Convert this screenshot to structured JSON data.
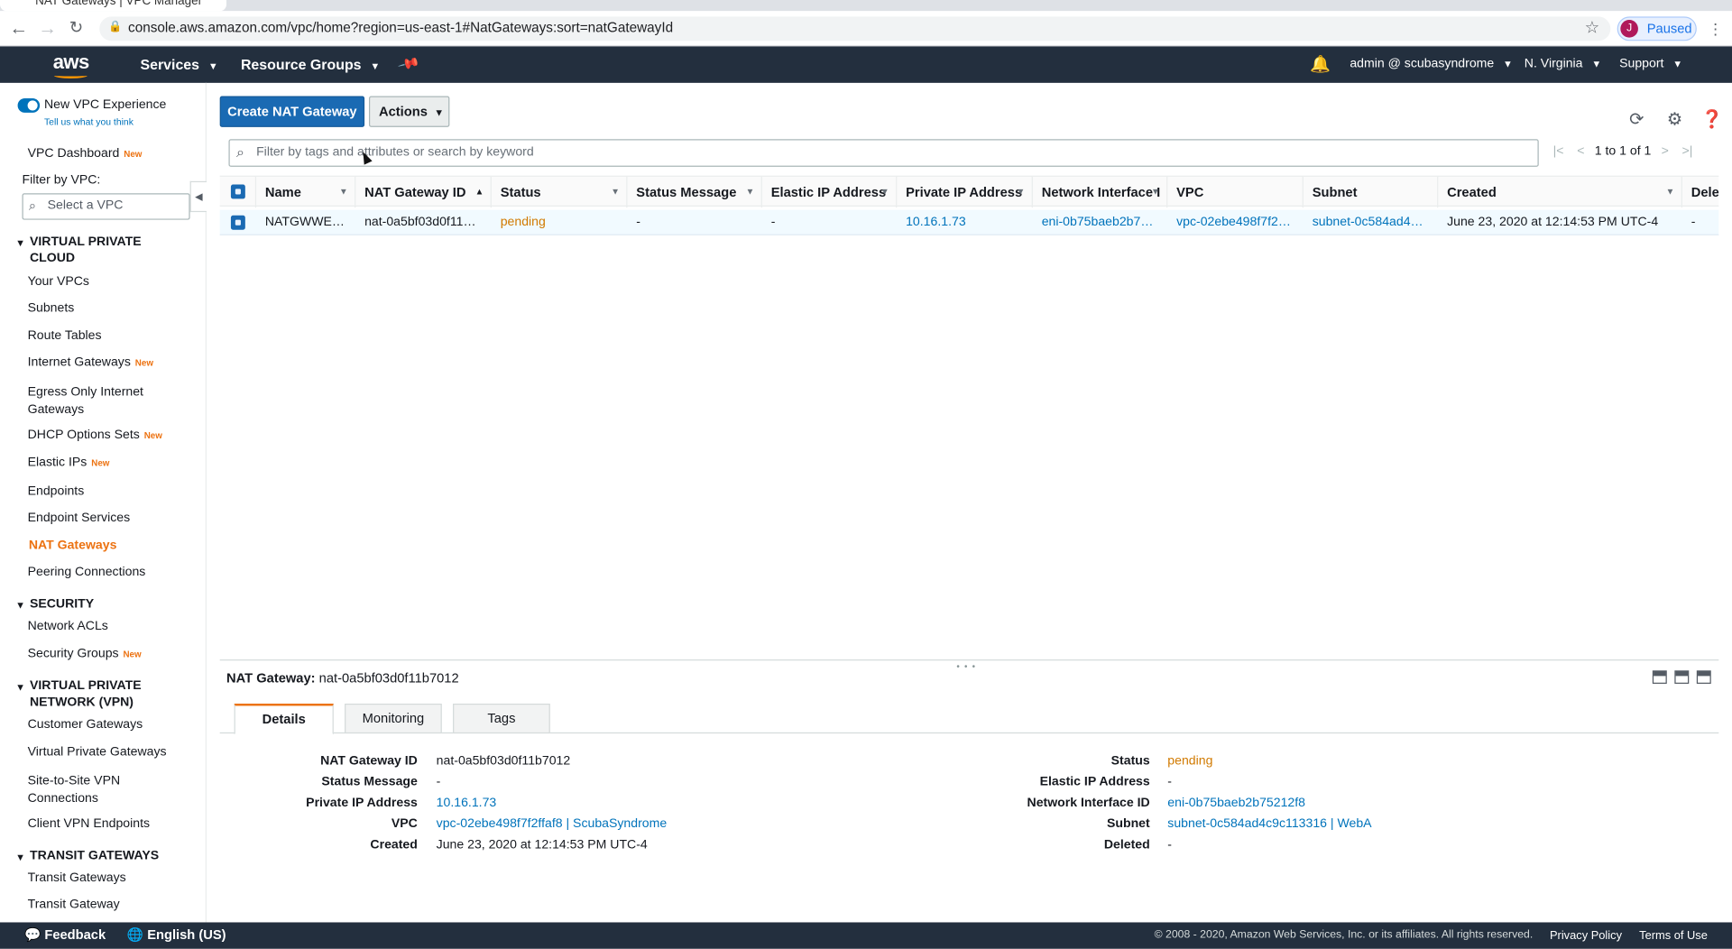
{
  "browser": {
    "tab_title": "NAT Gateways | VPC Manager",
    "url": "console.aws.amazon.com/vpc/home?region=us-east-1#NatGateways:sort=natGatewayId",
    "profile_initial": "J",
    "profile_status": "Paused"
  },
  "topnav": {
    "logo": "aws",
    "services": "Services",
    "resource_groups": "Resource Groups",
    "account": "admin @ scubasyndrome",
    "region": "N. Virginia",
    "support": "Support"
  },
  "sidebar": {
    "new_experience": "New VPC Experience",
    "tell_us": "Tell us what you think",
    "dashboard": "VPC Dashboard",
    "new_badge": "New",
    "filter_label": "Filter by VPC:",
    "vpc_placeholder": "Select a VPC",
    "sec_vpc": "VIRTUAL PRIVATE CLOUD",
    "items_vpc": [
      "Your VPCs",
      "Subnets",
      "Route Tables",
      "Internet Gateways",
      "Egress Only Internet Gateways",
      "DHCP Options Sets",
      "Elastic IPs",
      "Endpoints",
      "Endpoint Services",
      "NAT Gateways",
      "Peering Connections"
    ],
    "sec_security": "SECURITY",
    "items_security": [
      "Network ACLs",
      "Security Groups"
    ],
    "sec_vpn": "VIRTUAL PRIVATE NETWORK (VPN)",
    "items_vpn": [
      "Customer Gateways",
      "Virtual Private Gateways",
      "Site-to-Site VPN Connections",
      "Client VPN Endpoints"
    ],
    "sec_transit": "TRANSIT GATEWAYS",
    "items_transit": [
      "Transit Gateways",
      "Transit Gateway"
    ]
  },
  "toolbar": {
    "create": "Create NAT Gateway",
    "actions": "Actions",
    "search_placeholder": "Filter by tags and attributes or search by keyword",
    "pagination": "1 to 1 of 1"
  },
  "table": {
    "columns": [
      "Name",
      "NAT Gateway ID",
      "Status",
      "Status Message",
      "Elastic IP Address",
      "Private IP Address",
      "Network Interface I",
      "VPC",
      "Subnet",
      "Created",
      "Delet"
    ],
    "rows": [
      {
        "name": "NATGWWE…",
        "id": "nat-0a5bf03d0f11…",
        "status": "pending",
        "status_message": "-",
        "elastic_ip": "-",
        "private_ip": "10.16.1.73",
        "eni": "eni-0b75baeb2b7…",
        "vpc": "vpc-02ebe498f7f2…",
        "subnet": "subnet-0c584ad4…",
        "created": "June 23, 2020 at 12:14:53 PM UTC-4",
        "deleted": "-"
      }
    ]
  },
  "details": {
    "header_label": "NAT Gateway:",
    "header_id": "nat-0a5bf03d0f11b7012",
    "tabs": [
      "Details",
      "Monitoring",
      "Tags"
    ],
    "left": [
      {
        "label": "NAT Gateway ID",
        "value": "nat-0a5bf03d0f11b7012"
      },
      {
        "label": "Status Message",
        "value": "-"
      },
      {
        "label": "Private IP Address",
        "value": "10.16.1.73"
      },
      {
        "label": "VPC",
        "value": "vpc-02ebe498f7f2ffaf8 | ScubaSyndrome"
      },
      {
        "label": "Created",
        "value": "June 23, 2020 at 12:14:53 PM UTC-4"
      }
    ],
    "right": [
      {
        "label": "Status",
        "value": "pending"
      },
      {
        "label": "Elastic IP Address",
        "value": "-"
      },
      {
        "label": "Network Interface ID",
        "value": "eni-0b75baeb2b75212f8"
      },
      {
        "label": "Subnet",
        "value": "subnet-0c584ad4c9c113316 | WebA"
      },
      {
        "label": "Deleted",
        "value": "-"
      }
    ]
  },
  "footer": {
    "feedback": "Feedback",
    "language": "English (US)",
    "copyright": "© 2008 - 2020, Amazon Web Services, Inc. or its affiliates. All rights reserved.",
    "privacy": "Privacy Policy",
    "terms": "Terms of Use"
  },
  "colors": {
    "accent": "#ec7211",
    "link": "#0073bb",
    "primary_button": "#1a6ab3",
    "nav_bg": "#232f3e",
    "pending": "#d17a00"
  }
}
